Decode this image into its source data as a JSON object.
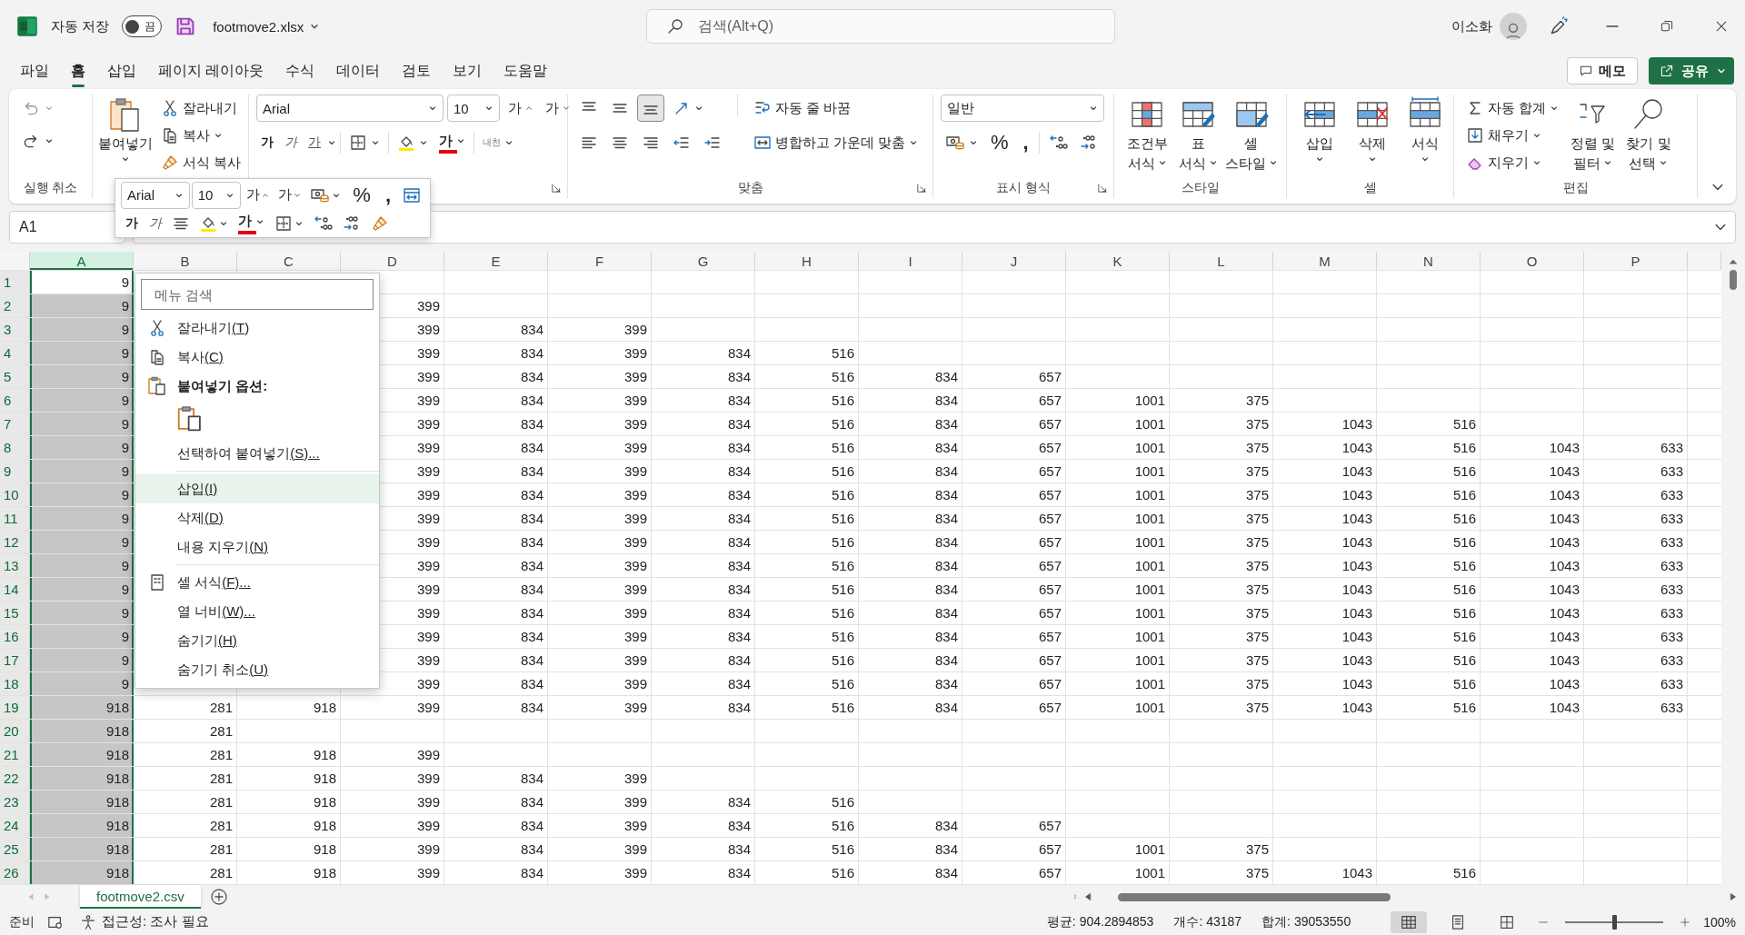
{
  "title_bar": {
    "autosave_label": "자동 저장",
    "autosave_state": "끔",
    "autosave_on": false,
    "filename": "footmove2.xlsx",
    "search_placeholder": "검색(Alt+Q)",
    "user_name": "이소화"
  },
  "tabs": [
    {
      "label": "파일",
      "selected": false
    },
    {
      "label": "홈",
      "selected": true
    },
    {
      "label": "삽입",
      "selected": false
    },
    {
      "label": "페이지 레이아웃",
      "selected": false
    },
    {
      "label": "수식",
      "selected": false
    },
    {
      "label": "데이터",
      "selected": false
    },
    {
      "label": "검토",
      "selected": false
    },
    {
      "label": "보기",
      "selected": false
    },
    {
      "label": "도움말",
      "selected": false
    }
  ],
  "comments_button": "메모",
  "share_button": "공유",
  "ribbon": {
    "undo": {
      "label": "실행 취소"
    },
    "clipboard": {
      "paste": "붙여넣기",
      "cut": "잘라내기",
      "copy": "복사",
      "format_painter": "서식 복사"
    },
    "font": {
      "name": "Arial",
      "size": "10",
      "grow": "가",
      "shrink": "가",
      "bold": "가",
      "italic": "가",
      "underline": "가",
      "font_color": "가",
      "phonetic": "내천"
    },
    "alignment": {
      "label": "맞춤",
      "wrap": "자동 줄 바꿈",
      "merge": "병합하고 가운데 맞춤",
      "vertical": [
        {
          "selected": false
        },
        {
          "selected": false
        },
        {
          "selected": true
        }
      ]
    },
    "number": {
      "label": "표시 형식",
      "format": "일반",
      "percent": "%",
      "comma": ","
    },
    "styles": {
      "label": "스타일",
      "buttons": [
        {
          "lines": [
            "조건부",
            "서식"
          ]
        },
        {
          "lines": [
            "표",
            "서식"
          ]
        },
        {
          "lines": [
            "셀",
            "스타일"
          ]
        }
      ]
    },
    "cells": {
      "label": "셀",
      "buttons": [
        {
          "lines": [
            "삽입"
          ]
        },
        {
          "lines": [
            "삭제"
          ]
        },
        {
          "lines": [
            "서식"
          ]
        }
      ]
    },
    "editing": {
      "label": "편집",
      "autosum": "자동 합계",
      "fill": "채우기",
      "clear": "지우기",
      "sort": [
        "정렬 및",
        "필터"
      ],
      "find": [
        "찾기 및",
        "선택"
      ]
    }
  },
  "name_box": "A1",
  "mini_toolbar": {
    "font": "Arial",
    "size": "10",
    "grow": "가",
    "shrink": "가",
    "percent": "%",
    "comma": ",",
    "bold": "가",
    "italic": "가",
    "font_color": "가"
  },
  "columns": [
    {
      "label": "A",
      "selected": true
    },
    {
      "label": "B",
      "selected": false
    },
    {
      "label": "C",
      "selected": false
    },
    {
      "label": "D",
      "selected": false
    },
    {
      "label": "E",
      "selected": false
    },
    {
      "label": "F",
      "selected": false
    },
    {
      "label": "G",
      "selected": false
    },
    {
      "label": "H",
      "selected": false
    },
    {
      "label": "I",
      "selected": false
    },
    {
      "label": "J",
      "selected": false
    },
    {
      "label": "K",
      "selected": false
    },
    {
      "label": "L",
      "selected": false
    },
    {
      "label": "M",
      "selected": false
    },
    {
      "label": "N",
      "selected": false
    },
    {
      "label": "O",
      "selected": false
    },
    {
      "label": "P",
      "selected": false
    }
  ],
  "rows": [
    {
      "number": "1",
      "active": true,
      "values_a_to_c": [
        "9"
      ]
    },
    {
      "number": "2",
      "active": false,
      "values_a_to_c": [
        "9"
      ],
      "values_from_d": [
        "399"
      ]
    },
    {
      "number": "3",
      "active": false,
      "values_a_to_c": [
        "9"
      ],
      "values_from_d": [
        "399",
        "834",
        "399"
      ]
    },
    {
      "number": "4",
      "active": false,
      "values_a_to_c": [
        "9"
      ],
      "values_from_d": [
        "399",
        "834",
        "399",
        "834",
        "516"
      ]
    },
    {
      "number": "5",
      "active": false,
      "values_a_to_c": [
        "9"
      ],
      "values_from_d": [
        "399",
        "834",
        "399",
        "834",
        "516",
        "834",
        "657"
      ]
    },
    {
      "number": "6",
      "active": false,
      "values_a_to_c": [
        "9"
      ],
      "values_from_d": [
        "399",
        "834",
        "399",
        "834",
        "516",
        "834",
        "657",
        "1001",
        "375"
      ]
    },
    {
      "number": "7",
      "active": false,
      "values_a_to_c": [
        "9"
      ],
      "values_from_d": [
        "399",
        "834",
        "399",
        "834",
        "516",
        "834",
        "657",
        "1001",
        "375",
        "1043",
        "516"
      ]
    },
    {
      "number": "8",
      "active": false,
      "values_a_to_c": [
        "9"
      ],
      "values_from_d": [
        "399",
        "834",
        "399",
        "834",
        "516",
        "834",
        "657",
        "1001",
        "375",
        "1043",
        "516",
        "1043",
        "633"
      ]
    },
    {
      "number": "9",
      "active": false,
      "values_a_to_c": [
        "9"
      ],
      "values_from_d": [
        "399",
        "834",
        "399",
        "834",
        "516",
        "834",
        "657",
        "1001",
        "375",
        "1043",
        "516",
        "1043",
        "633"
      ]
    },
    {
      "number": "10",
      "active": false,
      "values_a_to_c": [
        "9"
      ],
      "values_from_d": [
        "399",
        "834",
        "399",
        "834",
        "516",
        "834",
        "657",
        "1001",
        "375",
        "1043",
        "516",
        "1043",
        "633"
      ]
    },
    {
      "number": "11",
      "active": false,
      "values_a_to_c": [
        "9"
      ],
      "values_from_d": [
        "399",
        "834",
        "399",
        "834",
        "516",
        "834",
        "657",
        "1001",
        "375",
        "1043",
        "516",
        "1043",
        "633"
      ]
    },
    {
      "number": "12",
      "active": false,
      "values_a_to_c": [
        "9"
      ],
      "values_from_d": [
        "399",
        "834",
        "399",
        "834",
        "516",
        "834",
        "657",
        "1001",
        "375",
        "1043",
        "516",
        "1043",
        "633"
      ]
    },
    {
      "number": "13",
      "active": false,
      "values_a_to_c": [
        "9"
      ],
      "values_from_d": [
        "399",
        "834",
        "399",
        "834",
        "516",
        "834",
        "657",
        "1001",
        "375",
        "1043",
        "516",
        "1043",
        "633"
      ]
    },
    {
      "number": "14",
      "active": false,
      "values_a_to_c": [
        "9"
      ],
      "values_from_d": [
        "399",
        "834",
        "399",
        "834",
        "516",
        "834",
        "657",
        "1001",
        "375",
        "1043",
        "516",
        "1043",
        "633"
      ]
    },
    {
      "number": "15",
      "active": false,
      "values_a_to_c": [
        "9"
      ],
      "values_from_d": [
        "399",
        "834",
        "399",
        "834",
        "516",
        "834",
        "657",
        "1001",
        "375",
        "1043",
        "516",
        "1043",
        "633"
      ]
    },
    {
      "number": "16",
      "active": false,
      "values_a_to_c": [
        "9"
      ],
      "values_from_d": [
        "399",
        "834",
        "399",
        "834",
        "516",
        "834",
        "657",
        "1001",
        "375",
        "1043",
        "516",
        "1043",
        "633"
      ]
    },
    {
      "number": "17",
      "active": false,
      "values_a_to_c": [
        "9"
      ],
      "values_from_d": [
        "399",
        "834",
        "399",
        "834",
        "516",
        "834",
        "657",
        "1001",
        "375",
        "1043",
        "516",
        "1043",
        "633"
      ]
    },
    {
      "number": "18",
      "active": false,
      "values_a_to_c": [
        "9"
      ],
      "values_from_d": [
        "399",
        "834",
        "399",
        "834",
        "516",
        "834",
        "657",
        "1001",
        "375",
        "1043",
        "516",
        "1043",
        "633"
      ]
    },
    {
      "number": "19",
      "active": false,
      "values_a_to_c": [
        "918",
        "281",
        "918"
      ],
      "values_from_d": [
        "399",
        "834",
        "399",
        "834",
        "516",
        "834",
        "657",
        "1001",
        "375",
        "1043",
        "516",
        "1043",
        "633"
      ]
    },
    {
      "number": "20",
      "active": false,
      "values_a_to_c": [
        "918",
        "281"
      ]
    },
    {
      "number": "21",
      "active": false,
      "values_a_to_c": [
        "918",
        "281",
        "918"
      ],
      "values_from_d": [
        "399"
      ]
    },
    {
      "number": "22",
      "active": false,
      "values_a_to_c": [
        "918",
        "281",
        "918"
      ],
      "values_from_d": [
        "399",
        "834",
        "399"
      ]
    },
    {
      "number": "23",
      "active": false,
      "values_a_to_c": [
        "918",
        "281",
        "918"
      ],
      "values_from_d": [
        "399",
        "834",
        "399",
        "834",
        "516"
      ]
    },
    {
      "number": "24",
      "active": false,
      "values_a_to_c": [
        "918",
        "281",
        "918"
      ],
      "values_from_d": [
        "399",
        "834",
        "399",
        "834",
        "516",
        "834",
        "657"
      ]
    },
    {
      "number": "25",
      "active": false,
      "values_a_to_c": [
        "918",
        "281",
        "918"
      ],
      "values_from_d": [
        "399",
        "834",
        "399",
        "834",
        "516",
        "834",
        "657",
        "1001",
        "375"
      ]
    },
    {
      "number": "26",
      "active": false,
      "values_a_to_c": [
        "918",
        "281",
        "918"
      ],
      "values_from_d": [
        "399",
        "834",
        "399",
        "834",
        "516",
        "834",
        "657",
        "1001",
        "375",
        "1043",
        "516"
      ]
    }
  ],
  "context_menu": {
    "search_placeholder": "메뉴 검색",
    "items": [
      {
        "kind": "item",
        "label": "잘라내기",
        "key": "(T)",
        "selected": false
      },
      {
        "kind": "item",
        "label": "복사",
        "key": "(C)",
        "selected": false
      },
      {
        "kind": "header",
        "label": "붙여넣기 옵션:"
      },
      {
        "kind": "paste-options"
      },
      {
        "kind": "item",
        "label": "선택하여 붙여넣기",
        "key": "(S)...",
        "selected": false
      },
      {
        "kind": "divider"
      },
      {
        "kind": "item",
        "label": "삽입",
        "key": "(I)",
        "selected": true
      },
      {
        "kind": "item",
        "label": "삭제",
        "key": "(D)",
        "selected": false
      },
      {
        "kind": "item",
        "label": "내용 지우기",
        "key": "(N)",
        "selected": false
      },
      {
        "kind": "divider"
      },
      {
        "kind": "item",
        "label": "셀 서식",
        "key": "(F)...",
        "selected": false
      },
      {
        "kind": "item",
        "label": "열 너비",
        "key": "(W)...",
        "selected": false
      },
      {
        "kind": "item",
        "label": "숨기기",
        "key": "(H)",
        "selected": false
      },
      {
        "kind": "item",
        "label": "숨기기 취소",
        "key": "(U)",
        "selected": false
      }
    ]
  },
  "sheet_tabs": [
    {
      "label": "footmove2.csv",
      "selected": true
    }
  ],
  "status_bar": {
    "ready": "준비",
    "accessibility": "접근성: 조사 필요",
    "stats": [
      "평균: 904.2894853",
      "개수: 43187",
      "합계: 39053550"
    ],
    "views": [
      {
        "selected": true
      },
      {
        "selected": false
      },
      {
        "selected": false
      }
    ],
    "zoom": {
      "level": 0.5,
      "reading": "100%"
    }
  }
}
